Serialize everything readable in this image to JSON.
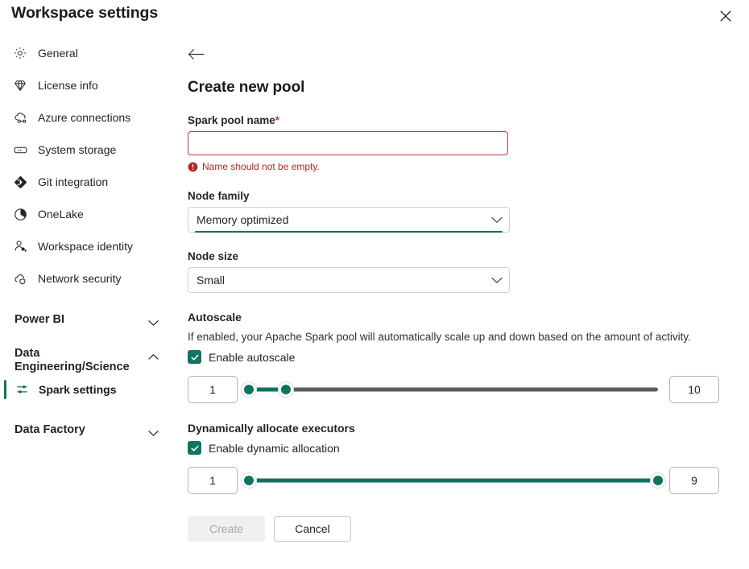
{
  "window": {
    "title": "Workspace settings",
    "close_label": "Close"
  },
  "sidebar": {
    "items": [
      {
        "label": "General",
        "icon": "gear-icon"
      },
      {
        "label": "License info",
        "icon": "gem-icon"
      },
      {
        "label": "Azure connections",
        "icon": "cloud-link-icon"
      },
      {
        "label": "System storage",
        "icon": "storage-icon"
      },
      {
        "label": "Git integration",
        "icon": "git-icon"
      },
      {
        "label": "OneLake",
        "icon": "onelake-icon"
      },
      {
        "label": "Workspace identity",
        "icon": "person-key-icon"
      },
      {
        "label": "Network security",
        "icon": "cloud-shield-icon"
      }
    ],
    "groups": [
      {
        "label": "Power BI",
        "expanded": false,
        "chevron": "chevron-down-icon"
      },
      {
        "label": "Data Engineering/Science",
        "expanded": true,
        "chevron": "chevron-up-icon"
      },
      {
        "label": "Data Factory",
        "expanded": false,
        "chevron": "chevron-down-icon"
      }
    ],
    "subitems": [
      {
        "label": "Spark settings",
        "icon": "sliders-icon",
        "selected": true
      }
    ]
  },
  "main": {
    "back_label": "Back",
    "heading": "Create new pool",
    "fields": {
      "pool_name": {
        "label": "Spark pool name",
        "required_marker": "*",
        "value": "",
        "placeholder": "",
        "error": "Name should not be empty."
      },
      "node_family": {
        "label": "Node family",
        "value": "Memory optimized",
        "options": [
          "Memory optimized"
        ]
      },
      "node_size": {
        "label": "Node size",
        "value": "Small",
        "options": [
          "Small"
        ]
      }
    },
    "autoscale": {
      "title": "Autoscale",
      "description": "If enabled, your Apache Spark pool will automatically scale up and down based on the amount of activity.",
      "checkbox_label": "Enable autoscale",
      "checked": true,
      "min_value": "1",
      "max_value": "10",
      "thumb_a_pct": 0,
      "thumb_b_pct": 9,
      "fill_end_pct": 9
    },
    "dynamic_allocation": {
      "title": "Dynamically allocate executors",
      "checkbox_label": "Enable dynamic allocation",
      "checked": true,
      "min_value": "1",
      "max_value": "9",
      "thumb_a_pct": 0,
      "thumb_b_pct": 100,
      "fill_end_pct": 100
    },
    "buttons": {
      "create": "Create",
      "create_disabled": true,
      "cancel": "Cancel"
    }
  },
  "colors": {
    "accent": "#0f7362",
    "checkbox": "#107560",
    "error": "#b3262a",
    "error_border": "#d13438",
    "rail": "#5c5c5c"
  }
}
